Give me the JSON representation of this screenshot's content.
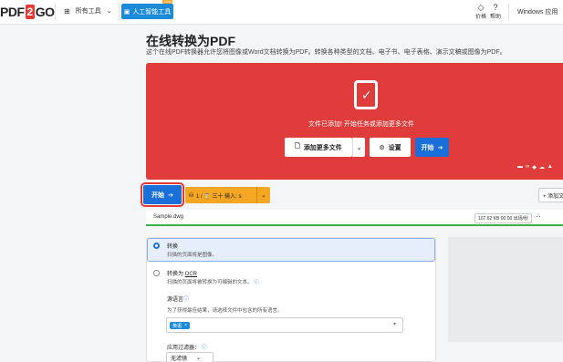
{
  "header": {
    "logo_left": "PDF",
    "logo_mid": "2",
    "logo_right": "GO",
    "all_tools_label": "所有工具",
    "ai_button_label": "人工智能工具",
    "ai_badge": "new",
    "pricing_label": "价格",
    "help_label": "帮助",
    "windows_label": "Windows 应用"
  },
  "page": {
    "title": "在线转换为PDF",
    "subtitle": "这个在线PDF转换器允许您将图像或Word文档转换为PDF。转换各种类型的文档、电子书、电子表格、演示文稿或图像为PDF。"
  },
  "dropzone": {
    "message": "文件已添加! 开始任务或添加更多文件",
    "add_more_label": "添加更多文件",
    "settings_label": "设置",
    "start_label": "开始"
  },
  "actions": {
    "start_label": "开始",
    "limits_text": "1 / ⌛ 三十 输入: s",
    "add_more_label": "+ 添加文件"
  },
  "file": {
    "name": "Sample.dwg",
    "size": "107.62 KB",
    "status": "00.00 出场/秒"
  },
  "options": {
    "convert_title": "转换",
    "convert_desc": "扫描的页面将是图像。",
    "ocr_title_prefix": "转换为 ",
    "ocr_title_link": "OCR",
    "ocr_desc": "扫描的页面将被转换为可编辑的文本。",
    "source_lang_label": "源语言",
    "source_lang_desc": "为了获得最佳结果，请选择文件中包含的所有语言。",
    "lang_chip": "英语",
    "filter_label": "应用过滤器：",
    "filter_value": "无滤镜"
  }
}
